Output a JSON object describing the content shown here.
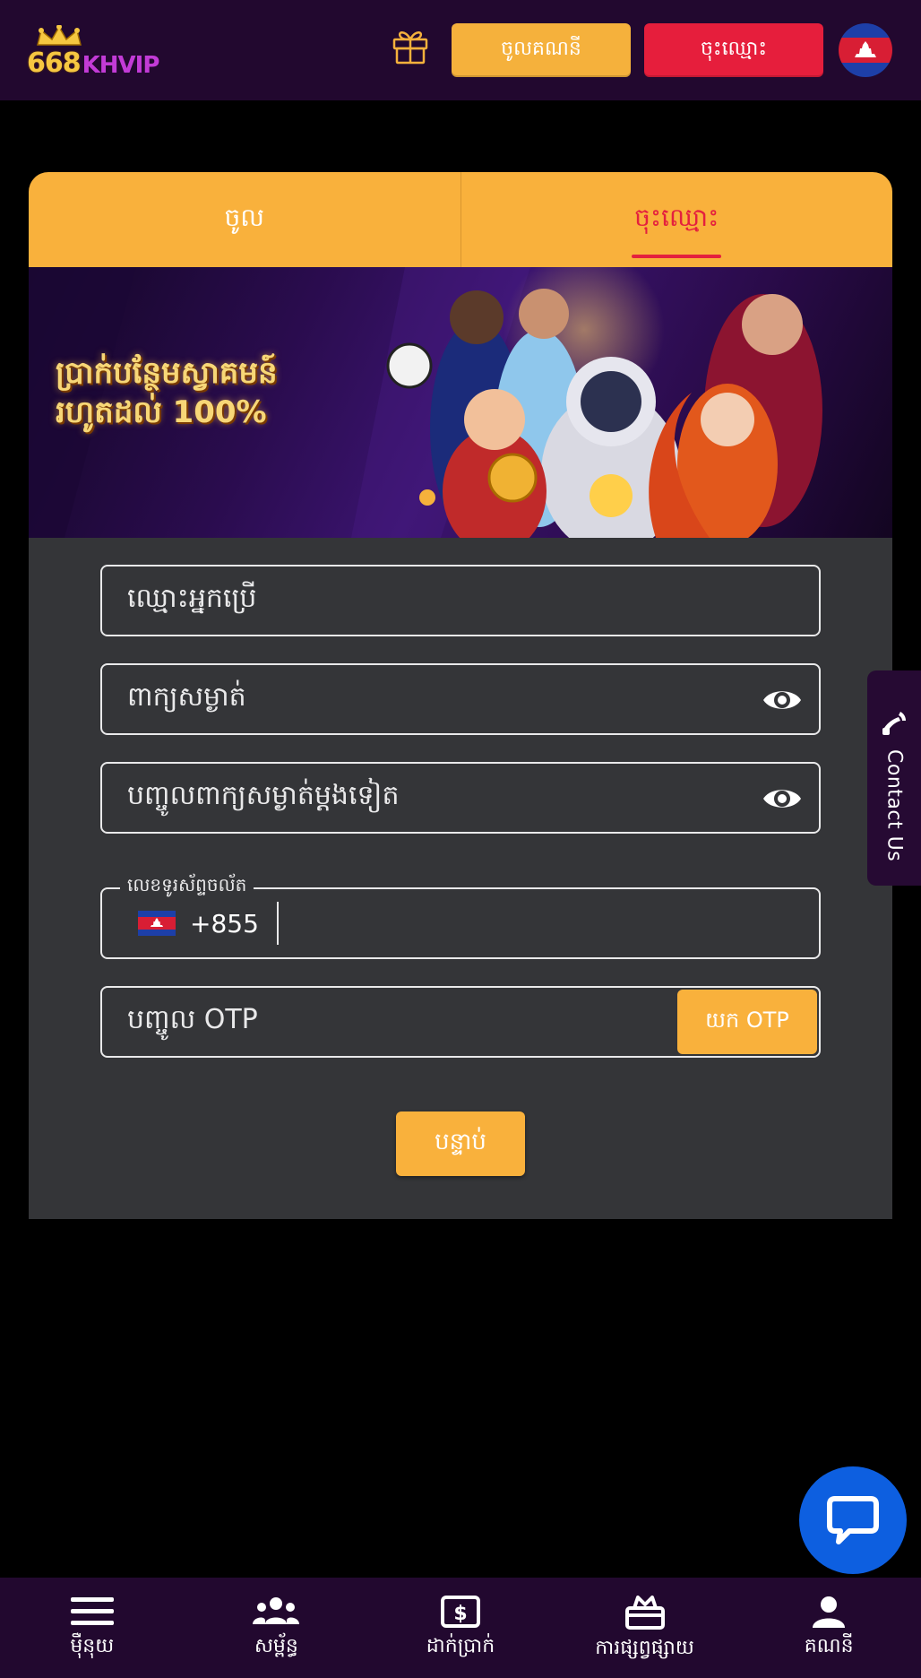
{
  "header": {
    "logo_num": "668",
    "logo_brand": "KHVIP",
    "gift_icon": "gift-icon",
    "login_label": "ចូលគណនី",
    "register_label": "ចុះឈ្មោះ",
    "flag_icon": "cambodia-flag-icon"
  },
  "tabs": {
    "login": "ចូល",
    "register": "ចុះឈ្មោះ"
  },
  "banner": {
    "line1": "ប្រាក់បន្ថែមស្វាគមន៍",
    "line2": "រហូតដល់ 100%"
  },
  "form": {
    "username_placeholder": "ឈ្មោះអ្នកប្រើ",
    "password_placeholder": "ពាក្យសម្ងាត់",
    "confirm_placeholder": "បញ្ចូលពាក្យសម្ងាត់ម្តងទៀត",
    "phone_label": "លេខទូរស័ព្ទចល័ត",
    "phone_code": "+855",
    "otp_placeholder": "បញ្ចូល OTP",
    "otp_button": "យក OTP",
    "next_button": "បន្ទាប់"
  },
  "contact": {
    "label": "Contact Us"
  },
  "bottom_nav": {
    "items": [
      {
        "label": "ម៉ឺនុយ",
        "icon": "menu-icon"
      },
      {
        "label": "សម្ព័ន្ធ",
        "icon": "group-icon"
      },
      {
        "label": "ដាក់ប្រាក់",
        "icon": "deposit-icon"
      },
      {
        "label": "ការផ្សព្វផ្សាយ",
        "icon": "promotion-icon"
      },
      {
        "label": "គណនី",
        "icon": "account-icon"
      }
    ]
  },
  "colors": {
    "header_bg": "#22082f",
    "accent_orange": "#f9b13c",
    "accent_red": "#e61e3c",
    "form_bg": "#343538",
    "chat_blue": "#0d5fe0"
  }
}
